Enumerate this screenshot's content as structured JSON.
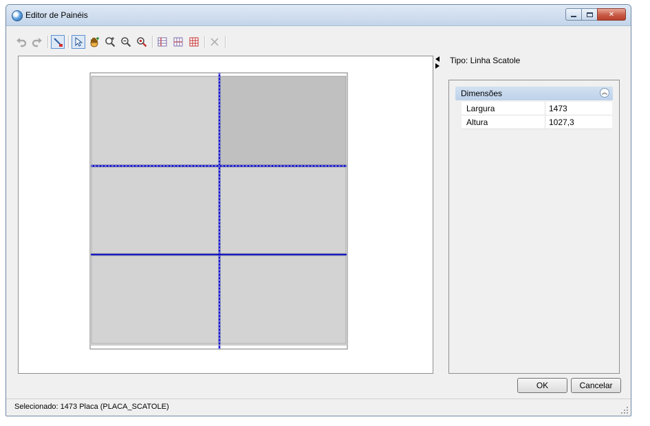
{
  "window": {
    "title": "Editor de Painéis",
    "icon": "app-globe-icon"
  },
  "titlebar_buttons": [
    "minimize-icon",
    "maximize-icon",
    "close-icon"
  ],
  "toolbar": {
    "buttons": [
      "undo-icon",
      "redo-icon",
      "draw-line-icon",
      "select-arrow-icon",
      "pan-hand-icon",
      "zoom-in-icon",
      "zoom-out-icon",
      "zoom-fit-icon",
      "split-vertical-icon",
      "split-horizontal-icon",
      "split-grid-icon",
      "delete-icon"
    ],
    "checked": [
      "draw-line-icon",
      "select-arrow-icon"
    ]
  },
  "properties": {
    "type_label": "Tipo: Linha Scatole",
    "group_title": "Dimensões",
    "rows": [
      {
        "label": "Largura",
        "value": "1473"
      },
      {
        "label": "Altura",
        "value": "1027,3"
      }
    ]
  },
  "buttons": {
    "ok": "OK",
    "cancel": "Cancelar"
  },
  "status": {
    "text": "Selecionado: 1473 Placa (PLACA_SCATOLE)"
  },
  "colors": {
    "panel_fill": "#d3d3d3",
    "panel_selected_fill": "#c0c0c0",
    "cut_line": "#0000cc"
  }
}
